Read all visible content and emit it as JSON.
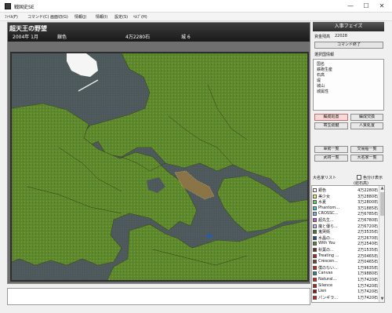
{
  "window": {
    "title": "戦国史SE",
    "minimize": "—",
    "maximize": "☐",
    "close": "✕"
  },
  "menu": [
    "ﾌｧｲﾙ(F)",
    "コマンド(C)",
    "画面切(G)",
    "情報(J)",
    "情報(I)",
    "設定(S)",
    "ﾍﾙﾌﾟ(H)"
  ],
  "status": {
    "scenario": "超天王の野望",
    "date": "2004年 1月",
    "clan": "銀色",
    "koku": "4万2280石",
    "castles": "城 6"
  },
  "panel": {
    "title": "入事フェイズ",
    "funds_label": "資金残高",
    "funds_value": "22028",
    "end_button": "コマンド終了",
    "selected_label": "選択国情報",
    "info_lines": [
      "国名",
      "鉄砲生産",
      "石高",
      "堤",
      "城山",
      "城属性"
    ],
    "buttons": [
      "編成処置",
      "編成交換",
      "寄生総鍵",
      "人質処置"
    ],
    "buttons2": [
      "軍勢一覧",
      "交易船一覧",
      "武将一覧",
      "大名家一覧"
    ],
    "clan_list_label": "大名家リスト",
    "show_label": "色分け表示",
    "list_header": "(総石高)"
  },
  "clans": [
    {
      "name": "銀色",
      "value": "4万2280石",
      "color": "#ffffff"
    },
    {
      "name": "美少女",
      "value": "3万2880石",
      "color": "#f2e86a"
    },
    {
      "name": "水夏",
      "value": "3万2800石",
      "color": "#57d45c"
    },
    {
      "name": "Phantom...",
      "value": "3万1885石",
      "color": "#3fc8c8"
    },
    {
      "name": "CROSSC...",
      "value": "2万6785石",
      "color": "#8aa8e0"
    },
    {
      "name": "超先生...",
      "value": "2万6780石",
      "color": "#b85ad0"
    },
    {
      "name": "魔と優ら...",
      "value": "2万6720石",
      "color": "#c7b4e8"
    },
    {
      "name": "鬼哭街",
      "value": "2万3535石",
      "color": "#3d7a2e"
    },
    {
      "name": "水晶の…",
      "value": "2万2670石",
      "color": "#1d4e8c"
    },
    {
      "name": "With You",
      "value": "2万2540石",
      "color": "#5f7f3a"
    },
    {
      "name": "秋葉の...",
      "value": "2万1535石",
      "color": "#6d2a2a"
    },
    {
      "name": "Treating ...",
      "value": "2万0465石",
      "color": "#b02020"
    },
    {
      "name": "Crescen...",
      "value": "2万0465石",
      "color": "#6a4a20"
    },
    {
      "name": "僕のない...",
      "value": "1万9635石",
      "color": "#cc2020"
    },
    {
      "name": "Canvas",
      "value": "1万9880石",
      "color": "#2a8a8a"
    },
    {
      "name": "Natural...",
      "value": "1万7420石",
      "color": "#d82020"
    },
    {
      "name": "Silence",
      "value": "1万7420石",
      "color": "#c01818"
    },
    {
      "name": "Lien",
      "value": "1万7420石",
      "color": "#a01010"
    },
    {
      "name": "パンギラ...",
      "value": "1万7420石",
      "color": "#c42020"
    }
  ]
}
